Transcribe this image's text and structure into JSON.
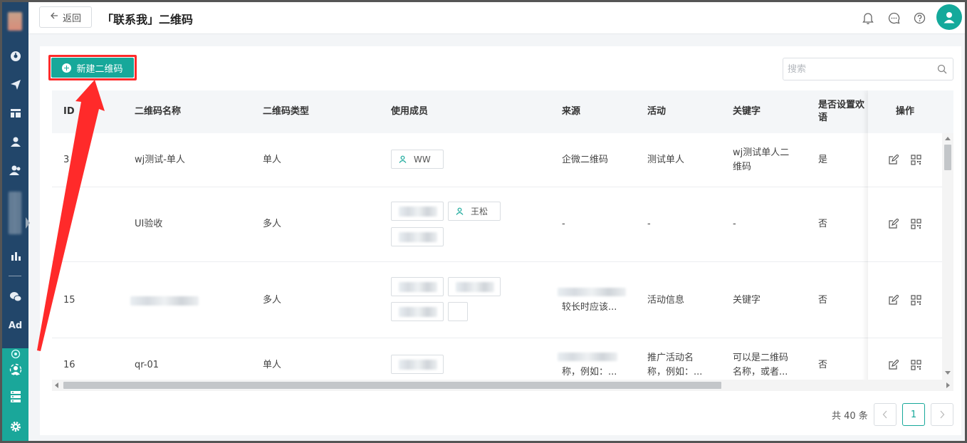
{
  "header": {
    "back_label": "返回",
    "title": "「联系我」二维码",
    "icons": [
      "bell-icon",
      "chat-icon",
      "help-icon"
    ],
    "avatar_icon": "user-icon"
  },
  "sidebar": {
    "items": [
      "dashboard-icon",
      "send-icon",
      "layout-icon",
      "user-icon",
      "users-icon",
      "bar-chart-icon",
      "wechat-icon",
      "ad-icon",
      "customer-icon",
      "server-icon",
      "gear-icon"
    ],
    "ad_label": "Ad"
  },
  "toolbar": {
    "new_label": "新建二维码",
    "search_placeholder": "搜索"
  },
  "table": {
    "columns": [
      "ID",
      "二维码名称",
      "二维码类型",
      "使用成员",
      "来源",
      "活动",
      "关键字",
      "是否设置欢语",
      "操作"
    ],
    "rows": [
      {
        "id": "3",
        "name": "wj测试-单人",
        "type": "单人",
        "member": "WW",
        "source": "企微二维码",
        "activity": "测试单人",
        "keyword": "wj测试单人二维码",
        "welcome": "是"
      },
      {
        "id": "",
        "name": "UI验收",
        "type": "多人",
        "member": "王松",
        "source": "-",
        "activity": "-",
        "keyword": "-",
        "welcome": "否"
      },
      {
        "id": "15",
        "name": "",
        "type": "多人",
        "member": "",
        "source": "较长时应该...",
        "activity": "活动信息",
        "keyword": "关键字",
        "welcome": "否"
      },
      {
        "id": "16",
        "name": "qr-01",
        "type": "单人",
        "member": "",
        "source": "称，例如：...",
        "activity": "推广活动名称，例如：...",
        "keyword": "可以是二维码名称，或者...",
        "welcome": "否"
      }
    ]
  },
  "pagination": {
    "total_label": "共 40 条",
    "current_page": "1"
  },
  "colors": {
    "accent": "#17a89a",
    "sidebar": "#22466a",
    "highlight": "#ff2a2a"
  }
}
